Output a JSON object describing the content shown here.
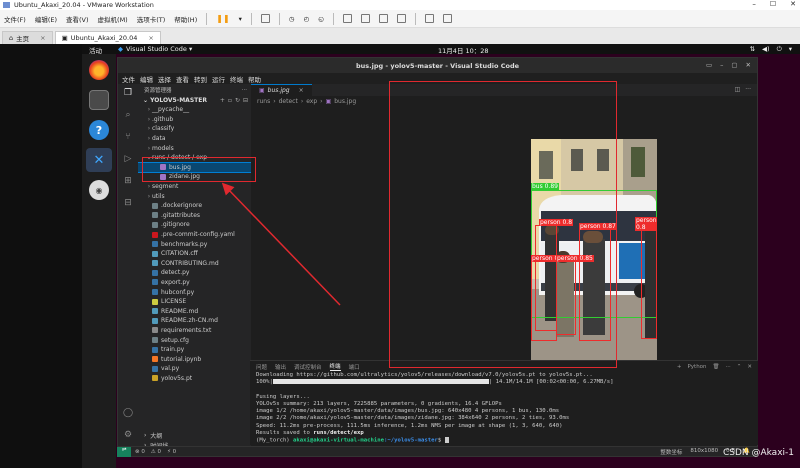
{
  "vmware": {
    "title": "Ubuntu_Akaxi_20.04 - VMware Workstation",
    "menu": [
      "文件(F)",
      "编辑(E)",
      "查看(V)",
      "虚拟机(M)",
      "选项卡(T)",
      "帮助(H)"
    ],
    "tabs": [
      {
        "label": "主页"
      },
      {
        "label": "Ubuntu_Akaxi_20.04"
      }
    ]
  },
  "ubuntu": {
    "activities": "活动",
    "app_menu": "Visual Studio Code ▾",
    "clock": "11月4日 10：28"
  },
  "vscode": {
    "title": "bus.jpg - yolov5-master - Visual Studio Code",
    "menu": [
      "文件",
      "编辑",
      "选择",
      "查看",
      "转到",
      "运行",
      "终端",
      "帮助"
    ],
    "explorer_header": "资源管理器",
    "root": "YOLOV5-MASTER",
    "tree": [
      {
        "label": "__pycache__",
        "depth": 1,
        "chev": "›",
        "kind": "folder"
      },
      {
        "label": ".github",
        "depth": 1,
        "chev": "›",
        "kind": "folder"
      },
      {
        "label": "classify",
        "depth": 1,
        "chev": "›",
        "kind": "folder"
      },
      {
        "label": "data",
        "depth": 1,
        "chev": "›",
        "kind": "folder"
      },
      {
        "label": "models",
        "depth": 1,
        "chev": "›",
        "kind": "folder"
      },
      {
        "label": "runs / detect / exp",
        "depth": 1,
        "chev": "⌄",
        "kind": "folder"
      },
      {
        "label": "bus.jpg",
        "depth": 2,
        "chev": "",
        "kind": "image",
        "selected": true
      },
      {
        "label": "zidane.jpg",
        "depth": 2,
        "chev": "",
        "kind": "image"
      },
      {
        "label": "segment",
        "depth": 1,
        "chev": "›",
        "kind": "folder"
      },
      {
        "label": "utils",
        "depth": 1,
        "chev": "›",
        "kind": "folder"
      },
      {
        "label": ".dockerignore",
        "depth": 1,
        "chev": "",
        "kind": "config"
      },
      {
        "label": ".gitattributes",
        "depth": 1,
        "chev": "",
        "kind": "config"
      },
      {
        "label": ".gitignore",
        "depth": 1,
        "chev": "",
        "kind": "config"
      },
      {
        "label": ".pre-commit-config.yaml",
        "depth": 1,
        "chev": "",
        "kind": "yaml"
      },
      {
        "label": "benchmarks.py",
        "depth": 1,
        "chev": "",
        "kind": "py"
      },
      {
        "label": "CITATION.cff",
        "depth": 1,
        "chev": "",
        "kind": "md"
      },
      {
        "label": "CONTRIBUTING.md",
        "depth": 1,
        "chev": "",
        "kind": "md"
      },
      {
        "label": "detect.py",
        "depth": 1,
        "chev": "",
        "kind": "py"
      },
      {
        "label": "export.py",
        "depth": 1,
        "chev": "",
        "kind": "py"
      },
      {
        "label": "hubconf.py",
        "depth": 1,
        "chev": "",
        "kind": "py"
      },
      {
        "label": "LICENSE",
        "depth": 1,
        "chev": "",
        "kind": "license"
      },
      {
        "label": "README.md",
        "depth": 1,
        "chev": "",
        "kind": "md"
      },
      {
        "label": "README.zh-CN.md",
        "depth": 1,
        "chev": "",
        "kind": "md"
      },
      {
        "label": "requirements.txt",
        "depth": 1,
        "chev": "",
        "kind": "txt"
      },
      {
        "label": "setup.cfg",
        "depth": 1,
        "chev": "",
        "kind": "config"
      },
      {
        "label": "train.py",
        "depth": 1,
        "chev": "",
        "kind": "py"
      },
      {
        "label": "tutorial.ipynb",
        "depth": 1,
        "chev": "",
        "kind": "ipynb"
      },
      {
        "label": "val.py",
        "depth": 1,
        "chev": "",
        "kind": "py"
      },
      {
        "label": "yolov5s.pt",
        "depth": 1,
        "chev": "",
        "kind": "pt"
      }
    ],
    "outline": "大纲",
    "timeline": "时间线",
    "tab": "bus.jpg",
    "breadcrumb": [
      "runs",
      "detect",
      "exp",
      "bus.jpg"
    ],
    "detections": [
      {
        "label": "bus 0.89"
      },
      {
        "label": "person 0.8"
      },
      {
        "label": "person 0.87"
      },
      {
        "label": "person 0.8"
      },
      {
        "label": "person 0.85"
      }
    ],
    "panel_tabs": [
      "问题",
      "输出",
      "调试控制台",
      "终端",
      "端口"
    ],
    "panel_active": "终端",
    "panel_right": "Python",
    "terminal": {
      "line1": "Downloading https://github.com/ultralytics/yolov5/releases/download/v7.0/yolov5s.pt to yolov5s.pt...",
      "line2_pre": "100%|",
      "line2_post": "| 14.1M/14.1M [00:02<00:00, 6.27MB/s]",
      "line3": "",
      "line4": "Fusing layers...",
      "line5": "YOLOv5s summary: 213 layers, 7225885 parameters, 0 gradients, 16.4 GFLOPs",
      "line6": "image 1/2 /home/akaxi/yolov5-master/data/images/bus.jpg: 640x480 4 persons, 1 bus, 130.0ms",
      "line7": "image 2/2 /home/akaxi/yolov5-master/data/images/zidane.jpg: 384x640 2 persons, 2 ties, 93.0ms",
      "line8": "Speed: 11.2ms pre-process, 111.5ms inference, 1.2ms NMS per image at shape (1, 3, 640, 640)",
      "line9_pre": "Results saved to ",
      "line9_bold": "runs/detect/exp",
      "prompt_env": "(My_torch) ",
      "prompt_user": "akaxi@akaxi-virtual-machine",
      "prompt_path": ":~/yolov5-master",
      "prompt_end": "$ "
    },
    "status_left": [
      "⊗ 0",
      "⚠ 0",
      "⚡ 0"
    ],
    "status_right": [
      "整数坐标",
      "810x1080",
      "0 B"
    ]
  },
  "watermark": "CSDN @Akaxi-1",
  "colors": {
    "annotation": "#e0292f",
    "vs_accent": "#007acc",
    "bus_box": "#33cc33",
    "person_box": "#ee2c2c"
  }
}
